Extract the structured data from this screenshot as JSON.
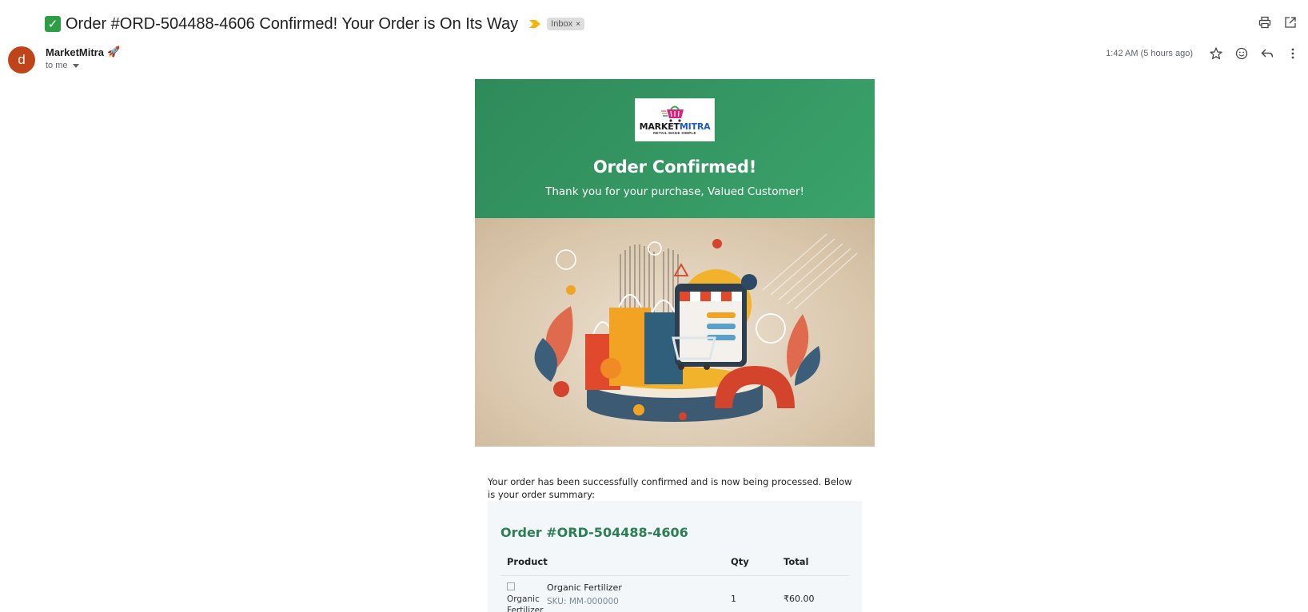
{
  "subject": {
    "check_glyph": "✓",
    "text": "Order #ORD-504488-4606 Confirmed! Your Order is On Its Way",
    "label": "Inbox",
    "label_remove": "×"
  },
  "sender": {
    "avatar_letter": "d",
    "name": "MarketMitra",
    "emoji": "🚀",
    "recipient": "to me",
    "timestamp": "1:42 AM (5 hours ago)"
  },
  "email": {
    "logo": {
      "word_a": "MARKET",
      "word_b": "MITRA",
      "tagline": "RETAIL MADE SIMPLE"
    },
    "hero_title": "Order Confirmed!",
    "hero_subtitle": "Thank you for your purchase, Valued Customer!",
    "intro": "Your order has been successfully confirmed and is now being processed. Below is your order summary:",
    "order_title": "Order #ORD-504488-4606",
    "table": {
      "headers": {
        "product": "Product",
        "qty": "Qty",
        "total": "Total"
      },
      "rows": [
        {
          "image_alt": "Organic Fertilizer",
          "name": "Organic Fertilizer",
          "sku": "SKU: MM-000000",
          "qty": "1",
          "total": "₹60.00"
        }
      ]
    }
  },
  "colors": {
    "header_green": "#2f8a5a",
    "order_green": "#2a7f53",
    "avatar": "#c0441a",
    "importance": "#f4b400"
  },
  "icons": [
    "print-icon",
    "open-in-new-icon",
    "star-icon",
    "emoji-icon",
    "reply-icon",
    "more-vert-icon",
    "importance-marker-icon"
  ]
}
